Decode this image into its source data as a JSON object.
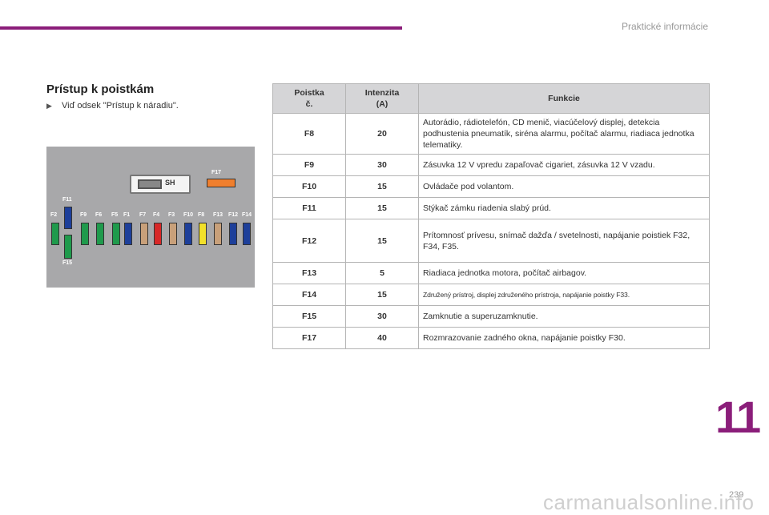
{
  "header": {
    "title": "Praktické informácie",
    "accent": "#8b1e7a"
  },
  "section": {
    "title": "Prístup k poistkám",
    "bullet_icon": "arrow-right-icon",
    "bullet": "Viď odsek \"Prístup k náradiu\"."
  },
  "figure": {
    "sh_label": "SH",
    "top_labels": {
      "f11": "F11",
      "f17": "F17"
    },
    "bottom_label": "F15",
    "labels": [
      "F2",
      "F9",
      "F6",
      "F5",
      "F1",
      "F7",
      "F4",
      "F3",
      "F10",
      "F8",
      "F13",
      "F12",
      "F14"
    ]
  },
  "table": {
    "headers": {
      "fuse": "Poistka\nč.",
      "amperage": "Intenzita\n(A)",
      "function": "Funkcie"
    },
    "rows": [
      {
        "fuse": "F8",
        "amps": "20",
        "function": "Autorádio, rádiotelefón, CD menič, viacúčelový displej, detekcia podhustenia pneumatík, siréna alarmu, počítač alarmu, riadiaca jednotka telematiky."
      },
      {
        "fuse": "F9",
        "amps": "30",
        "function": "Zásuvka 12 V vpredu zapaľovač cigariet, zásuvka 12 V vzadu."
      },
      {
        "fuse": "F10",
        "amps": "15",
        "function": "Ovládače pod volantom."
      },
      {
        "fuse": "F11",
        "amps": "15",
        "function": "Stýkač zámku riadenia slabý prúd."
      },
      {
        "fuse": "F12",
        "amps": "15",
        "function": "Prítomnosť prívesu, snímač dažďa / svetelnosti, napájanie poistiek F32, F34, F35."
      },
      {
        "fuse": "F13",
        "amps": "5",
        "function": "Riadiaca jednotka motora, počítač airbagov."
      },
      {
        "fuse": "F14",
        "amps": "15",
        "function": "Združený prístroj, displej združeného prístroja, napájanie poistky F33."
      },
      {
        "fuse": "F15",
        "amps": "30",
        "function": "Zamknutie a superuzamknutie."
      },
      {
        "fuse": "F17",
        "amps": "40",
        "function": "Rozmrazovanie zadného okna, napájanie poistky F30."
      }
    ]
  },
  "chapter_number": "11",
  "page_number": "239",
  "watermark": "carmanualsonline.info"
}
